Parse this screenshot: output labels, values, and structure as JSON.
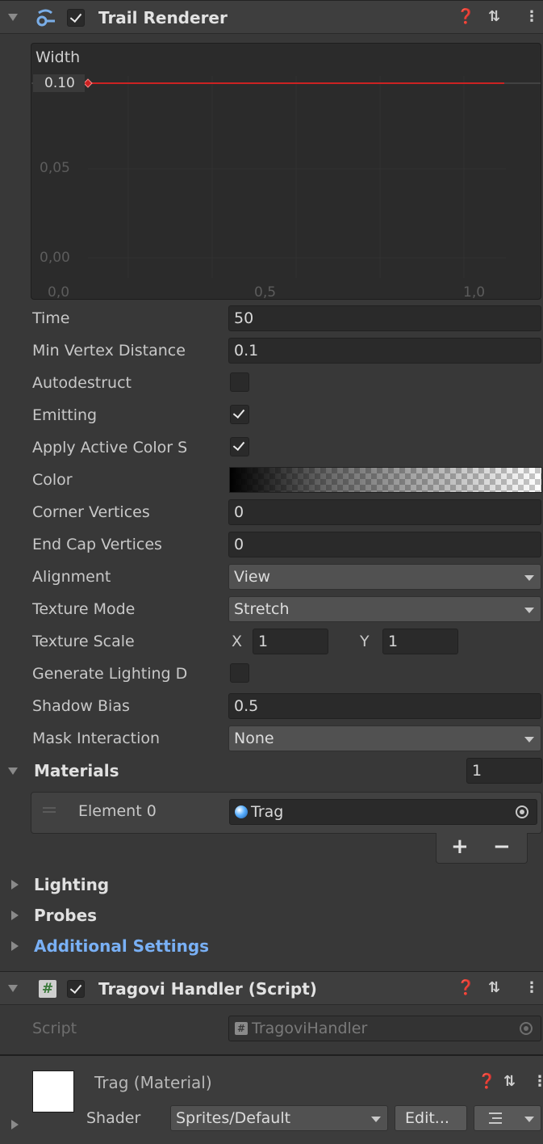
{
  "trail_renderer": {
    "title": "Trail Renderer",
    "width_curve": {
      "label": "Width",
      "value_tag": "0.10",
      "y_ticks": [
        "0,05",
        "0,00"
      ],
      "x_ticks": [
        "0,0",
        "0,5",
        "1,0"
      ]
    },
    "fields": {
      "time": {
        "label": "Time",
        "value": "50"
      },
      "min_vertex": {
        "label": "Min Vertex Distance",
        "value": "0.1"
      },
      "autodestruct": {
        "label": "Autodestruct"
      },
      "emitting": {
        "label": "Emitting"
      },
      "apply_active": {
        "label": "Apply Active Color S"
      },
      "color": {
        "label": "Color"
      },
      "corner_vertices": {
        "label": "Corner Vertices",
        "value": "0"
      },
      "end_cap_vertices": {
        "label": "End Cap Vertices",
        "value": "0"
      },
      "alignment": {
        "label": "Alignment",
        "value": "View"
      },
      "texture_mode": {
        "label": "Texture Mode",
        "value": "Stretch"
      },
      "texture_scale": {
        "label": "Texture Scale",
        "x_label": "X",
        "x_value": "1",
        "y_label": "Y",
        "y_value": "1"
      },
      "generate_lighting": {
        "label": "Generate Lighting D"
      },
      "shadow_bias": {
        "label": "Shadow Bias",
        "value": "0.5"
      },
      "mask_interaction": {
        "label": "Mask Interaction",
        "value": "None"
      }
    },
    "materials": {
      "label": "Materials",
      "count": "1",
      "element_label": "Element 0",
      "element_value": "Trag",
      "add": "+",
      "remove": "−"
    },
    "sections": {
      "lighting": "Lighting",
      "probes": "Probes",
      "additional": "Additional Settings"
    }
  },
  "script_component": {
    "title": "Tragovi Handler (Script)",
    "script_label": "Script",
    "script_value": "TragoviHandler"
  },
  "material_preview": {
    "title": "Trag (Material)",
    "shader_label": "Shader",
    "shader_value": "Sprites/Default",
    "edit_label": "Edit..."
  },
  "header_icons": {
    "help": "❓",
    "presets": "⇅",
    "menu": "⋮"
  },
  "colors": {
    "accent_blue": "#79b0f5",
    "curve_red": "#cc2222"
  }
}
